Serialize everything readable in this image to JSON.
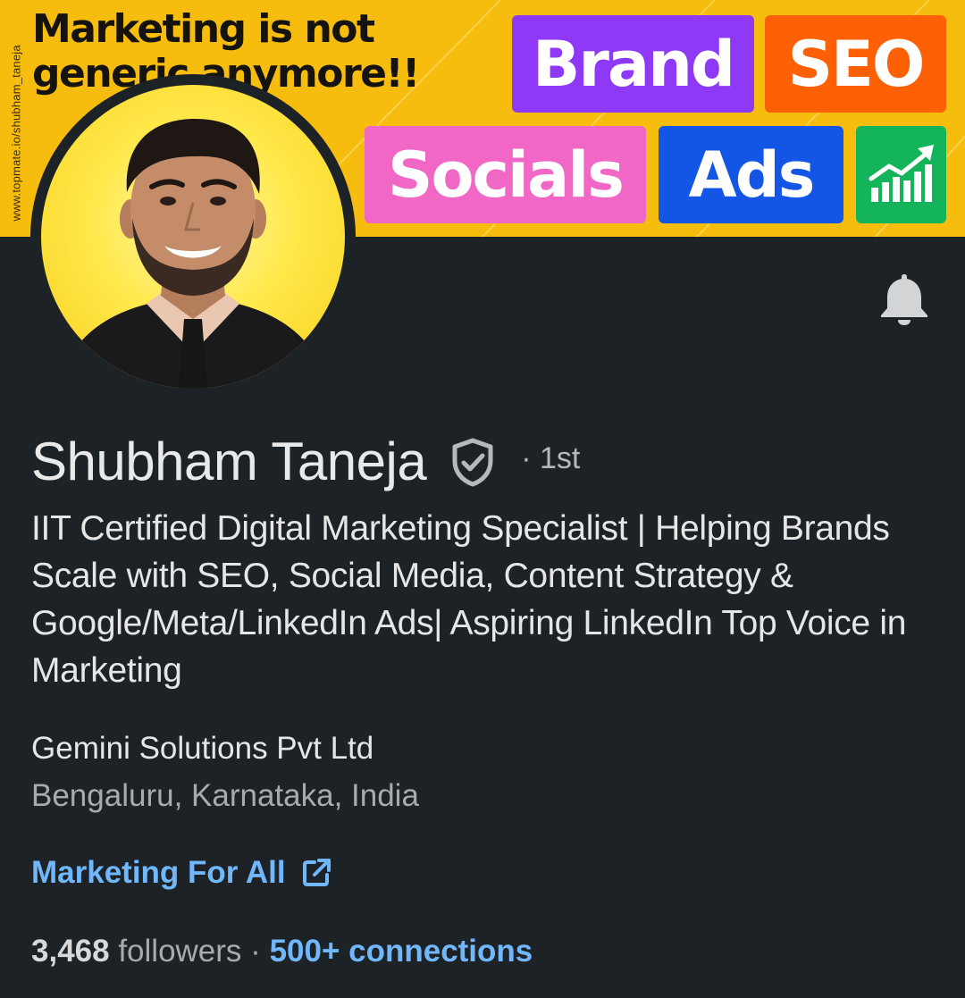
{
  "banner": {
    "side_url": "www.topmate.io/shubham_taneja",
    "headline_line1": "Marketing is not",
    "headline_line2": "generic anymore!!",
    "tags": {
      "brand": "Brand",
      "seo": "SEO",
      "socials": "Socials",
      "ads": "Ads"
    },
    "tag_colors": {
      "brand": "#8d39f6",
      "seo": "#fd6005",
      "socials": "#f067c5",
      "ads": "#1356e6",
      "chart": "#14b45a"
    },
    "background_color": "#f6bd0e"
  },
  "profile": {
    "name": "Shubham Taneja",
    "connection_degree": "· 1st",
    "headline": "IIT Certified Digital Marketing Specialist | Helping Brands Scale with SEO, Social Media, Content Strategy & Google/Meta/LinkedIn Ads| Aspiring LinkedIn Top Voice in Marketing",
    "company": "Gemini Solutions Pvt Ltd",
    "location": "Bengaluru, Karnataka, India",
    "website_label": "Marketing For All",
    "followers_count": "3,468",
    "followers_label": "followers",
    "separator": "·",
    "connections": "500+ connections"
  },
  "icons": {
    "bell": "bell-icon",
    "verified": "verified-shield-icon",
    "external_link": "external-link-icon",
    "growth_chart": "growth-chart-icon"
  },
  "colors": {
    "page_background": "#1d2226",
    "link": "#71b7fb"
  }
}
